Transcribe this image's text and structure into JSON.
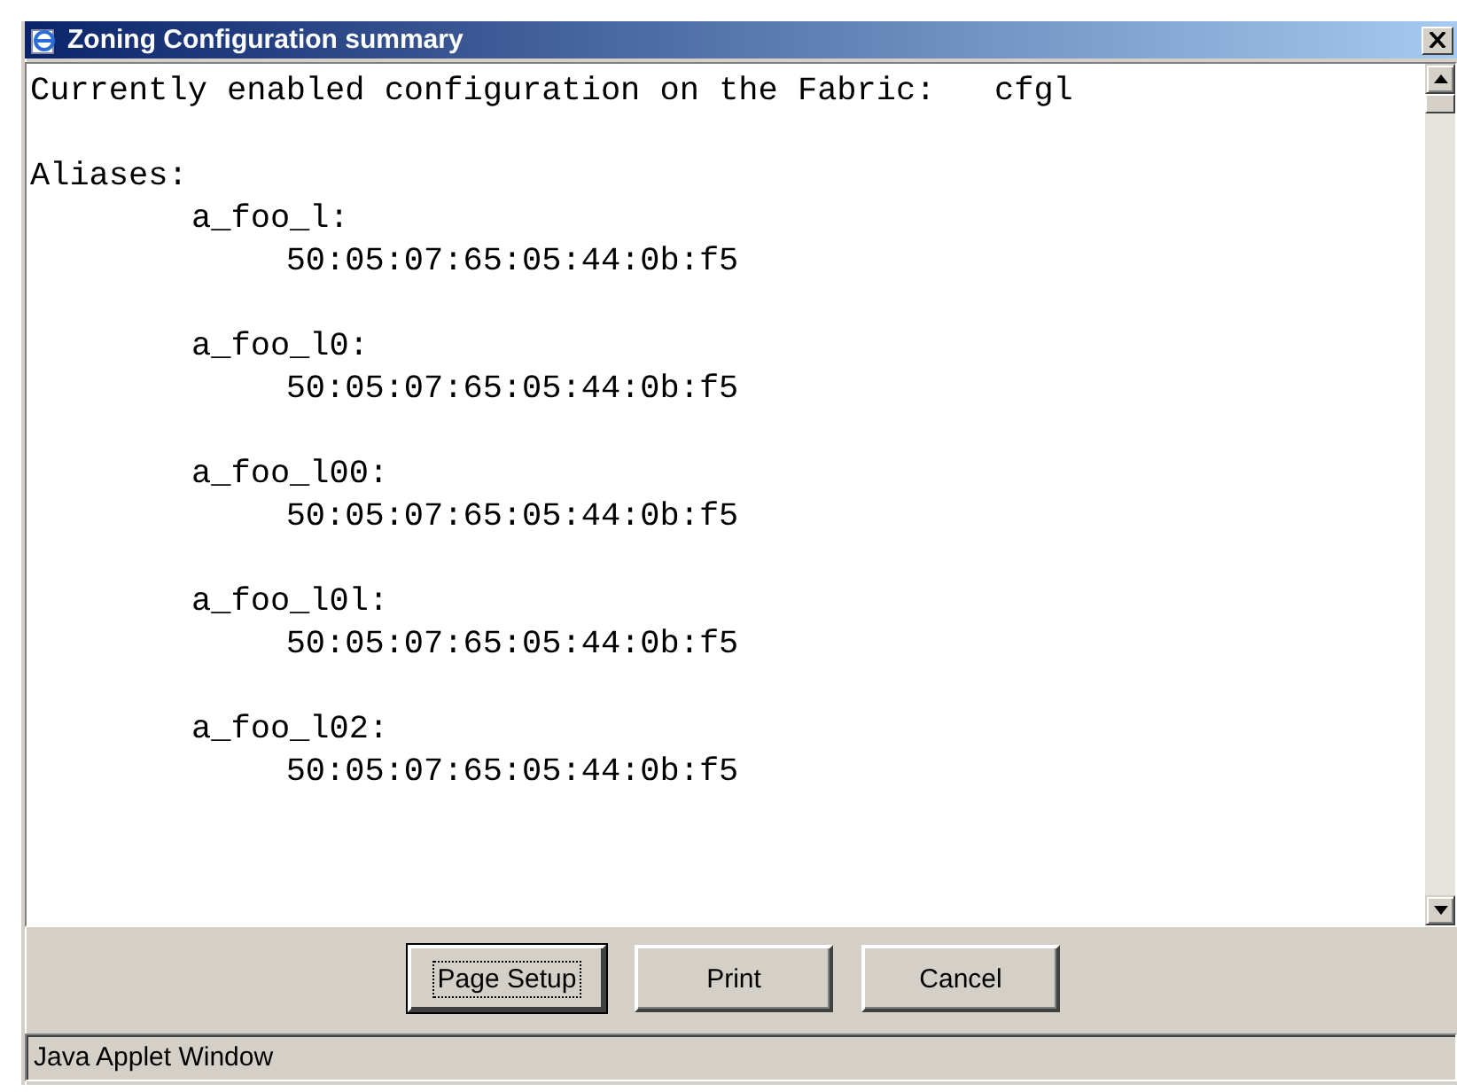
{
  "window": {
    "title": "Zoning Configuration summary"
  },
  "summary": {
    "header_label": "Currently enabled configuration on the Fabric:",
    "header_value": "cfgl",
    "section_title": "Aliases:",
    "aliases": [
      {
        "name": "a_foo_l:",
        "members": [
          "50:05:07:65:05:44:0b:f5"
        ]
      },
      {
        "name": "a_foo_l0:",
        "members": [
          "50:05:07:65:05:44:0b:f5"
        ]
      },
      {
        "name": "a_foo_l00:",
        "members": [
          "50:05:07:65:05:44:0b:f5"
        ]
      },
      {
        "name": "a_foo_l0l:",
        "members": [
          "50:05:07:65:05:44:0b:f5"
        ]
      },
      {
        "name": "a_foo_l02:",
        "members": [
          "50:05:07:65:05:44:0b:f5"
        ]
      }
    ]
  },
  "buttons": [
    {
      "label": "Page Setup",
      "focused": true
    },
    {
      "label": "Print",
      "focused": false
    },
    {
      "label": "Cancel",
      "focused": false
    }
  ],
  "status_bar": {
    "text": "Java Applet Window"
  }
}
